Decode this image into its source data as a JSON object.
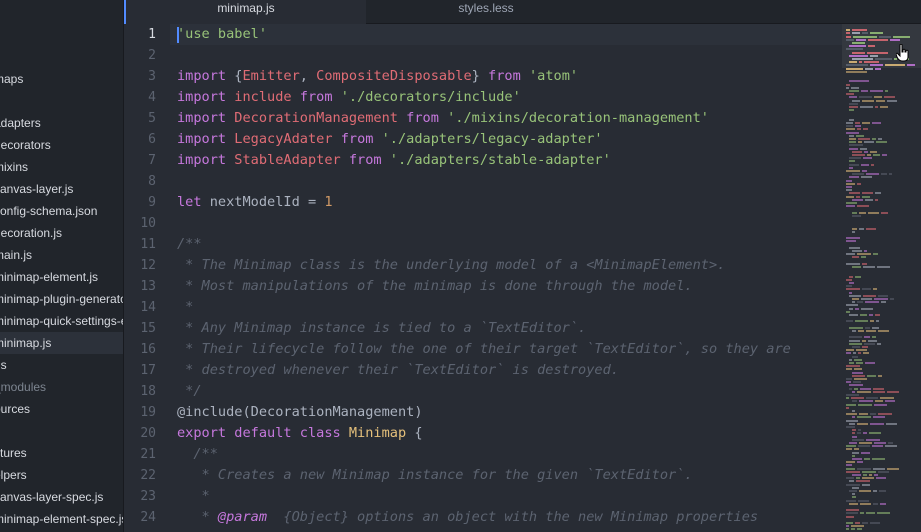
{
  "sidebar": {
    "items": [
      {
        "label": "maps",
        "state": "normal"
      },
      {
        "label": "adapters",
        "state": "normal"
      },
      {
        "label": "decorators",
        "state": "normal"
      },
      {
        "label": "mixins",
        "state": "normal"
      },
      {
        "label": "canvas-layer.js",
        "state": "normal"
      },
      {
        "label": "config-schema.json",
        "state": "normal"
      },
      {
        "label": "decoration.js",
        "state": "normal"
      },
      {
        "label": "main.js",
        "state": "normal"
      },
      {
        "label": "minimap-element.js",
        "state": "normal"
      },
      {
        "label": "minimap-plugin-generator",
        "state": "normal"
      },
      {
        "label": "minimap-quick-settings-element",
        "state": "normal"
      },
      {
        "label": "minimap.js",
        "state": "selected"
      },
      {
        "label": "us",
        "state": "normal"
      },
      {
        "label": "_modules",
        "state": "dim"
      },
      {
        "label": "ources",
        "state": "normal"
      },
      {
        "label": "xtures",
        "state": "normal"
      },
      {
        "label": "elpers",
        "state": "normal"
      },
      {
        "label": "canvas-layer-spec.js",
        "state": "normal"
      },
      {
        "label": "minimap-element-spec.js",
        "state": "normal"
      }
    ]
  },
  "tabs": [
    {
      "label": "minimap.js",
      "active": true
    },
    {
      "label": "styles.less",
      "active": false
    }
  ],
  "editor": {
    "current_line": 1,
    "lines": [
      {
        "n": "1",
        "tokens": [
          [
            "str",
            "'use babel'"
          ]
        ]
      },
      {
        "n": "2",
        "tokens": []
      },
      {
        "n": "3",
        "tokens": [
          [
            "kw",
            "import "
          ],
          [
            "pl",
            "{"
          ],
          [
            "var",
            "Emitter"
          ],
          [
            "pl",
            ", "
          ],
          [
            "var",
            "CompositeDisposable"
          ],
          [
            "pl",
            "} "
          ],
          [
            "kw",
            "from "
          ],
          [
            "str",
            "'atom'"
          ]
        ]
      },
      {
        "n": "4",
        "tokens": [
          [
            "kw",
            "import "
          ],
          [
            "var",
            "include "
          ],
          [
            "kw",
            "from "
          ],
          [
            "str",
            "'./decorators/include'"
          ]
        ]
      },
      {
        "n": "5",
        "tokens": [
          [
            "kw",
            "import "
          ],
          [
            "var",
            "DecorationManagement "
          ],
          [
            "kw",
            "from "
          ],
          [
            "str",
            "'./mixins/decoration-management'"
          ]
        ]
      },
      {
        "n": "6",
        "tokens": [
          [
            "kw",
            "import "
          ],
          [
            "var",
            "LegacyAdater "
          ],
          [
            "kw",
            "from "
          ],
          [
            "str",
            "'./adapters/legacy-adapter'"
          ]
        ]
      },
      {
        "n": "7",
        "tokens": [
          [
            "kw",
            "import "
          ],
          [
            "var",
            "StableAdapter "
          ],
          [
            "kw",
            "from "
          ],
          [
            "str",
            "'./adapters/stable-adapter'"
          ]
        ]
      },
      {
        "n": "8",
        "tokens": []
      },
      {
        "n": "9",
        "tokens": [
          [
            "kw",
            "let "
          ],
          [
            "pl",
            "nextModelId = "
          ],
          [
            "num",
            "1"
          ]
        ]
      },
      {
        "n": "10",
        "tokens": []
      },
      {
        "n": "11",
        "tokens": [
          [
            "cm",
            "/**"
          ]
        ]
      },
      {
        "n": "12",
        "tokens": [
          [
            "cm",
            " * The Minimap class is the underlying model of a <MinimapElement>."
          ]
        ]
      },
      {
        "n": "13",
        "tokens": [
          [
            "cm",
            " * Most manipulations of the minimap is done through the model."
          ]
        ]
      },
      {
        "n": "14",
        "tokens": [
          [
            "cm",
            " *"
          ]
        ]
      },
      {
        "n": "15",
        "tokens": [
          [
            "cm",
            " * Any Minimap instance is tied to a `TextEditor`."
          ]
        ]
      },
      {
        "n": "16",
        "tokens": [
          [
            "cm",
            " * Their lifecycle follow the one of their target `TextEditor`, so they are"
          ]
        ]
      },
      {
        "n": "17",
        "tokens": [
          [
            "cm",
            " * destroyed whenever their `TextEditor` is destroyed."
          ]
        ]
      },
      {
        "n": "18",
        "tokens": [
          [
            "cm",
            " */"
          ]
        ]
      },
      {
        "n": "19",
        "tokens": [
          [
            "pl",
            "@include(DecorationManagement)"
          ]
        ]
      },
      {
        "n": "20",
        "tokens": [
          [
            "kw",
            "export default class "
          ],
          [
            "cls",
            "Minimap "
          ],
          [
            "pl",
            "{"
          ]
        ]
      },
      {
        "n": "21",
        "tokens": [
          [
            "cm",
            "  /**"
          ]
        ]
      },
      {
        "n": "22",
        "tokens": [
          [
            "cm",
            "   * Creates a new Minimap instance for the given `TextEditor`."
          ]
        ]
      },
      {
        "n": "23",
        "tokens": [
          [
            "cm",
            "   *"
          ]
        ]
      },
      {
        "n": "24",
        "tokens": [
          [
            "cm",
            "   * "
          ],
          [
            "tag",
            "@param"
          ],
          [
            "cm",
            "  {Object} options an object with the new Minimap properties"
          ]
        ]
      }
    ]
  },
  "icons": {
    "pointer": "hand-pointer-icon"
  },
  "colors": {
    "editor_bg": "#282c34",
    "sidebar_bg": "#21252b",
    "accent": "#528bff",
    "keyword": "#c678dd",
    "string": "#98c379",
    "variable": "#e06c75",
    "class": "#e5c07b",
    "number": "#d19a66",
    "comment": "#5c6370"
  }
}
